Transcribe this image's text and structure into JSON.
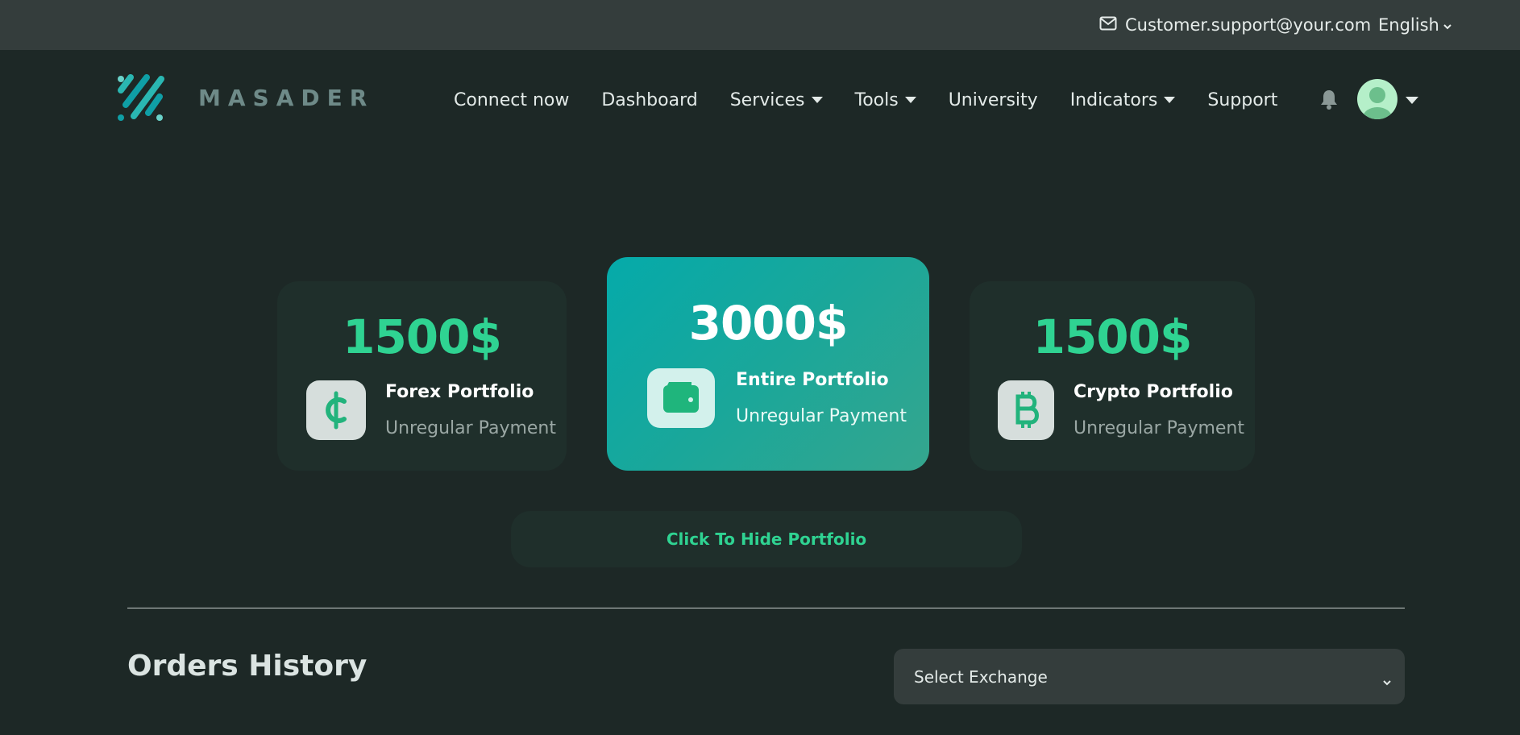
{
  "topbar": {
    "support_email": "Customer.support@your.com",
    "language": "English",
    "mail_icon": "envelope-icon",
    "lang_icon": "chevron-down-icon"
  },
  "brand": {
    "name": "MASADER",
    "logo_colors": [
      "#0f9fa6",
      "#2ab7b2",
      "#6ad2c9"
    ]
  },
  "nav": {
    "items": [
      {
        "label": "Connect now",
        "has_dropdown": false
      },
      {
        "label": "Dashboard",
        "has_dropdown": false
      },
      {
        "label": "Services",
        "has_dropdown": true
      },
      {
        "label": "Tools",
        "has_dropdown": true
      },
      {
        "label": "University",
        "has_dropdown": false
      },
      {
        "label": "Indicators",
        "has_dropdown": true
      },
      {
        "label": "Support",
        "has_dropdown": false
      }
    ],
    "bell_icon": "bell-icon",
    "avatar_icon": "user-avatar-icon"
  },
  "cards": {
    "forex": {
      "amount": "1500$",
      "title": "Forex Portfolio",
      "subtitle": "Unregular Payment",
      "icon": "cedi-icon"
    },
    "entire": {
      "amount": "3000$",
      "title": "Entire Portfolio",
      "subtitle": "Unregular Payment",
      "icon": "wallet-icon"
    },
    "crypto": {
      "amount": "1500$",
      "title": "Crypto Portfolio",
      "subtitle": "Unregular Payment",
      "icon": "bitcoin-icon"
    }
  },
  "hide_button": "Click To Hide Portfolio",
  "orders": {
    "title": "Orders History",
    "select_placeholder": "Select Exchange"
  },
  "colors": {
    "accent": "#2fd392",
    "background": "#1d2826",
    "card": "#1f2f2b",
    "topbar": "#343d3c"
  }
}
